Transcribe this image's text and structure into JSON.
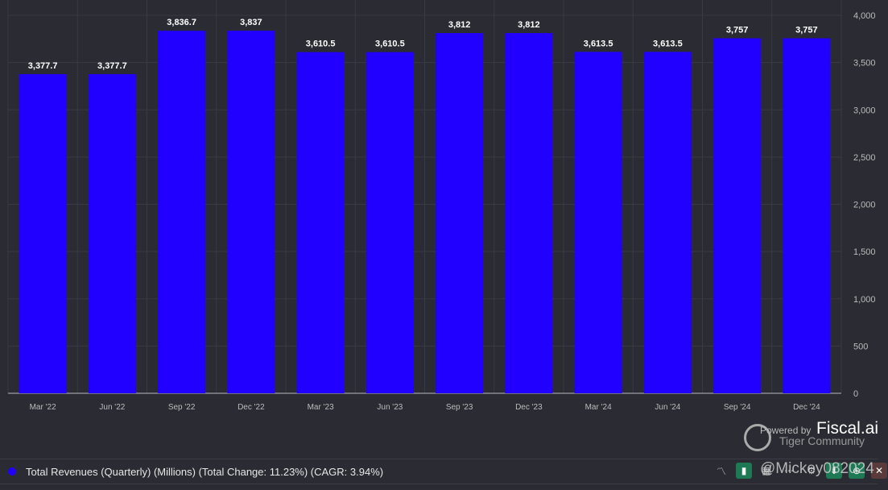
{
  "chart_data": {
    "type": "bar",
    "title": "",
    "categories": [
      "Mar '22",
      "Jun '22",
      "Sep '22",
      "Dec '22",
      "Mar '23",
      "Jun '23",
      "Sep '23",
      "Dec '23",
      "Mar '24",
      "Jun '24",
      "Sep '24",
      "Dec '24"
    ],
    "values": [
      3377.7,
      3377.7,
      3836.7,
      3837,
      3610.5,
      3610.5,
      3812,
      3812,
      3613.5,
      3613.5,
      3757,
      3757
    ],
    "labels": [
      "3,377.7",
      "3,377.7",
      "3,836.7",
      "3,837",
      "3,610.5",
      "3,610.5",
      "3,812",
      "3,812",
      "3,613.5",
      "3,613.5",
      "3,757",
      "3,757"
    ],
    "yticks": [
      "0",
      "500",
      "1,000",
      "1,500",
      "2,000",
      "2,500",
      "3,000",
      "3,500",
      "4,000"
    ],
    "ylim": [
      0,
      4000
    ],
    "grid": true,
    "color": "#2200ff",
    "xlabel": "",
    "ylabel": ""
  },
  "legend": {
    "label": "Total Revenues (Quarterly) (Millions) (Total Change: 11.23%) (CAGR: 3.94%)"
  },
  "branding": {
    "powered": "Powered by",
    "name": "Fiscal.ai",
    "watermark_sub": "Tiger Community",
    "watermark_user": "@Mickey082024"
  }
}
